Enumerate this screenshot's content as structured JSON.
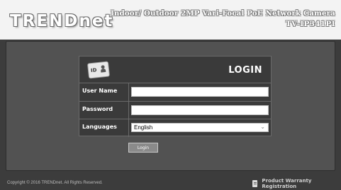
{
  "header": {
    "logo": "TRENDnet",
    "product_title": "Indoor/ Outdoor 2MP Vari-Focal PoE Network Camera",
    "model": "TV-IP341PI"
  },
  "login_panel": {
    "title": "LOGIN",
    "id_icon_text": "ID",
    "fields": {
      "username_label": "User Name",
      "username_value": "",
      "password_label": "Password",
      "password_value": "",
      "language_label": "Languages",
      "language_value": "English"
    },
    "login_button": "Login"
  },
  "footer": {
    "copyright": "Copyright © 2016 TRENDnet. All Rights Reserved.",
    "warranty_link": "Product Warranty Registration"
  },
  "colors": {
    "background": "#3c3c3c",
    "header_background": "#f3f3f3",
    "panel_background": "#3a3a3a",
    "content_background": "#525252"
  }
}
